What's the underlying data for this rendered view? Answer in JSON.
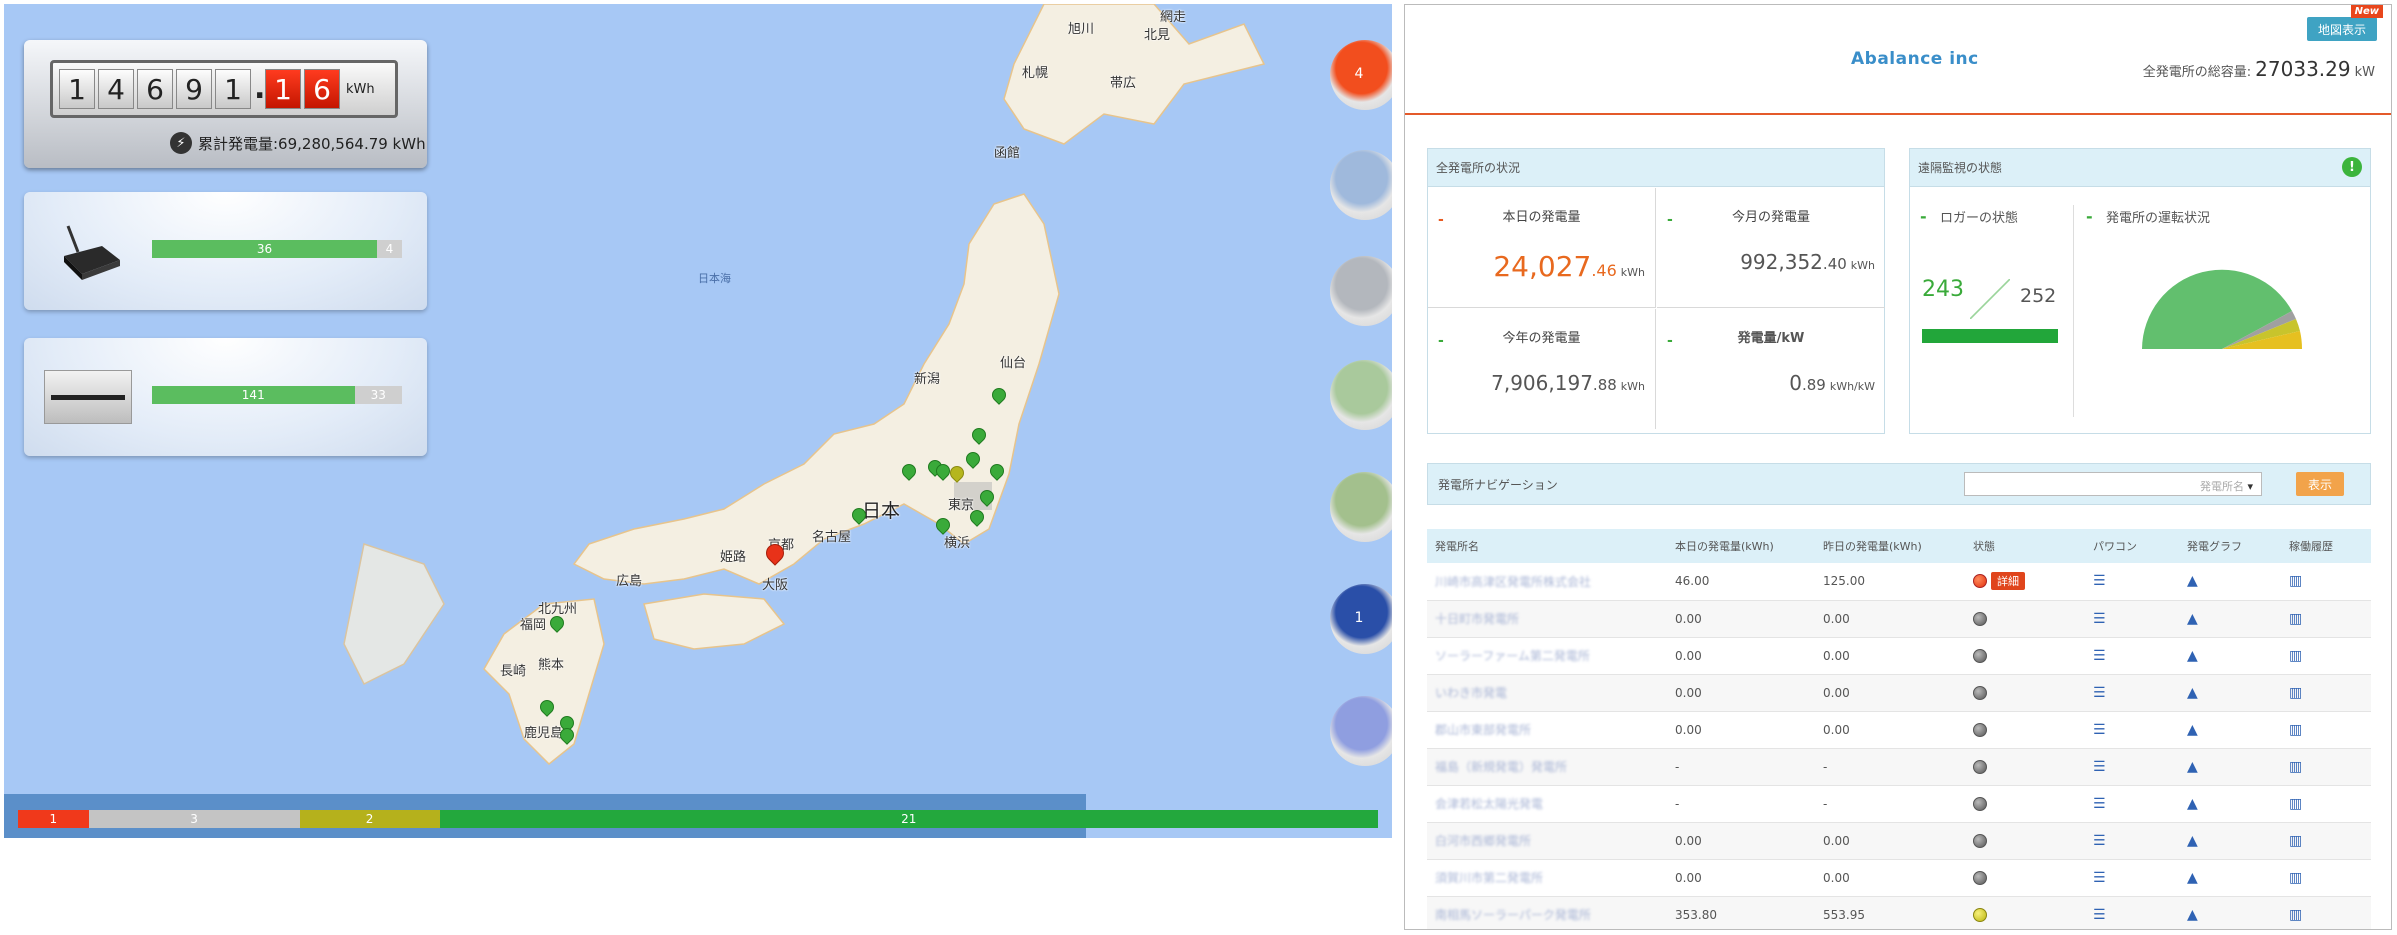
{
  "map": {
    "sea_label": "日本海",
    "country_label": "日本",
    "cities": [
      "旭川",
      "網走",
      "北見",
      "札幌",
      "帯広",
      "函館",
      "新潟",
      "仙台",
      "東京",
      "横浜",
      "名古屋",
      "京都",
      "大阪",
      "姫路",
      "広島",
      "北九州",
      "福岡",
      "熊本",
      "長崎",
      "鹿児島"
    ]
  },
  "meter": {
    "digits": [
      "1",
      "4",
      "6",
      "9",
      "1"
    ],
    "decimals": [
      "1",
      "6"
    ],
    "unit": "kWh",
    "cumulative": "累計発電量:69,280,564.79 kWh"
  },
  "logger": {
    "ok": "36",
    "ng": "4",
    "ok_fraction": 0.9
  },
  "pcs": {
    "ok": "141",
    "ng": "33",
    "ok_fraction": 0.81
  },
  "side_circles": [
    {
      "label": "4",
      "color": "#f24e1e"
    },
    {
      "label": "",
      "color": "#9fb9dc"
    },
    {
      "label": "",
      "color": "#b3b7bd"
    },
    {
      "label": "",
      "color": "#a9c99c"
    },
    {
      "label": "",
      "color": "#a3c08d"
    },
    {
      "label": "1",
      "color": "#2a4fa8"
    },
    {
      "label": "",
      "color": "#8f9ee0"
    }
  ],
  "status_bar": [
    {
      "label": "1",
      "color": "#f0391b",
      "fraction": 0.052
    },
    {
      "label": "3",
      "color": "#c4c4c4",
      "fraction": 0.155
    },
    {
      "label": "2",
      "color": "#b5b11c",
      "fraction": 0.103
    },
    {
      "label": "21",
      "color": "#23a83d",
      "fraction": 0.69
    }
  ],
  "dash": {
    "company": "Abalance inc",
    "capacity_label": "全発電所の総容量:",
    "capacity_value": "27033.29",
    "capacity_unit": "kW",
    "map_button": "地図表示",
    "new_badge": "New",
    "overview": {
      "title": "全発電所の状況",
      "today_label": "本日の発電量",
      "today_int": "24,027",
      "today_dec": ".46",
      "today_unit": "kWh",
      "month_label": "今月の発電量",
      "month_int": "992,352",
      "month_dec": ".40",
      "month_unit": "kWh",
      "year_label": "今年の発電量",
      "year_int": "7,906,197",
      "year_dec": ".88",
      "year_unit": "kWh",
      "per_kw_label": "発電量/kW",
      "per_kw_int": "0",
      "per_kw_dec": ".89",
      "per_kw_unit": "kWh/kW"
    },
    "monitor": {
      "title": "遠隔監視の状態",
      "logger_label": "ロガーの状態",
      "logger_ok": "243",
      "logger_total": "252",
      "operation_label": "発電所の運転状況"
    },
    "navigation": {
      "title": "発電所ナビゲーション",
      "select_value": "発電所名",
      "show_button": "表示"
    },
    "table": {
      "headers": [
        "発電所名",
        "本日の発電量(kWh)",
        "昨日の発電量(kWh)",
        "状態",
        "パワコン",
        "発電グラフ",
        "稼働履歴"
      ],
      "detail_label": "詳細",
      "rows": [
        {
          "name": "川崎市高津区発電所株式会社",
          "today": "46.00",
          "yesterday": "125.00",
          "status": "red"
        },
        {
          "name": "十日町市発電所",
          "today": "0.00",
          "yesterday": "0.00",
          "status": "gray"
        },
        {
          "name": "ソーラーファーム第二発電所",
          "today": "0.00",
          "yesterday": "0.00",
          "status": "gray"
        },
        {
          "name": "いわき市発電",
          "today": "0.00",
          "yesterday": "0.00",
          "status": "gray"
        },
        {
          "name": "郡山市東部発電所",
          "today": "0.00",
          "yesterday": "0.00",
          "status": "gray"
        },
        {
          "name": "福島（新規発電）発電所",
          "today": "-",
          "yesterday": "-",
          "status": "gray"
        },
        {
          "name": "会津若松太陽光発電",
          "today": "-",
          "yesterday": "-",
          "status": "gray"
        },
        {
          "name": "白河市西郷発電所",
          "today": "0.00",
          "yesterday": "0.00",
          "status": "gray"
        },
        {
          "name": "須賀川市第二発電所",
          "today": "0.00",
          "yesterday": "0.00",
          "status": "gray"
        },
        {
          "name": "南相馬ソーラーパーク発電所",
          "today": "353.80",
          "yesterday": "553.95",
          "status": "yellow"
        }
      ]
    }
  }
}
